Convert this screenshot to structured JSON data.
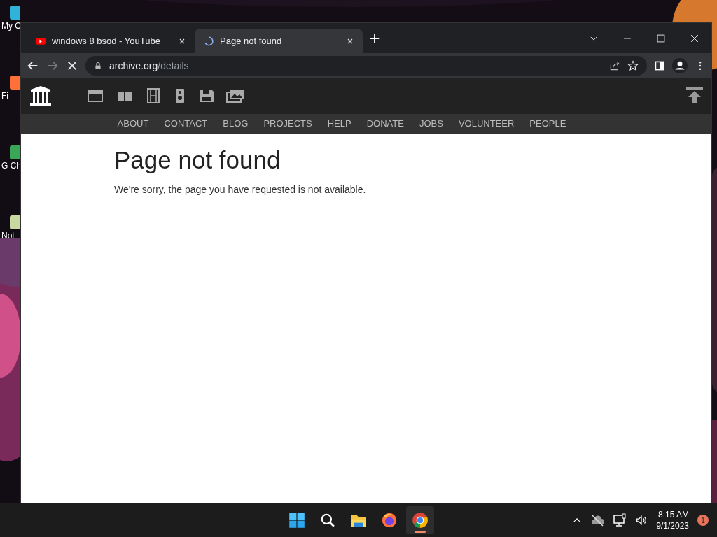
{
  "desktop_icons": [
    {
      "label": "My C"
    },
    {
      "label": "Fi"
    },
    {
      "label": "G Ch"
    },
    {
      "label": "Not"
    }
  ],
  "browser": {
    "tabs": [
      {
        "title": "windows 8 bsod - YouTube",
        "selected": false,
        "kind": "video"
      },
      {
        "title": "Page not found",
        "selected": true,
        "kind": "loading"
      }
    ],
    "address": {
      "host": "archive.org",
      "path": "/details"
    }
  },
  "site": {
    "nav": [
      "ABOUT",
      "CONTACT",
      "BLOG",
      "PROJECTS",
      "HELP",
      "DONATE",
      "JOBS",
      "VOLUNTEER",
      "PEOPLE"
    ],
    "heading": "Page not found",
    "message": "We're sorry, the page you have requested is not available."
  },
  "taskbar": {
    "apps": [
      {
        "kind": "start",
        "selected": false
      },
      {
        "kind": "search",
        "selected": false
      },
      {
        "kind": "files",
        "selected": false
      },
      {
        "kind": "firefox",
        "selected": false
      },
      {
        "kind": "chrome",
        "selected": true
      }
    ],
    "time": "8:15 AM",
    "date": "9/1/2023",
    "badge": "1"
  }
}
